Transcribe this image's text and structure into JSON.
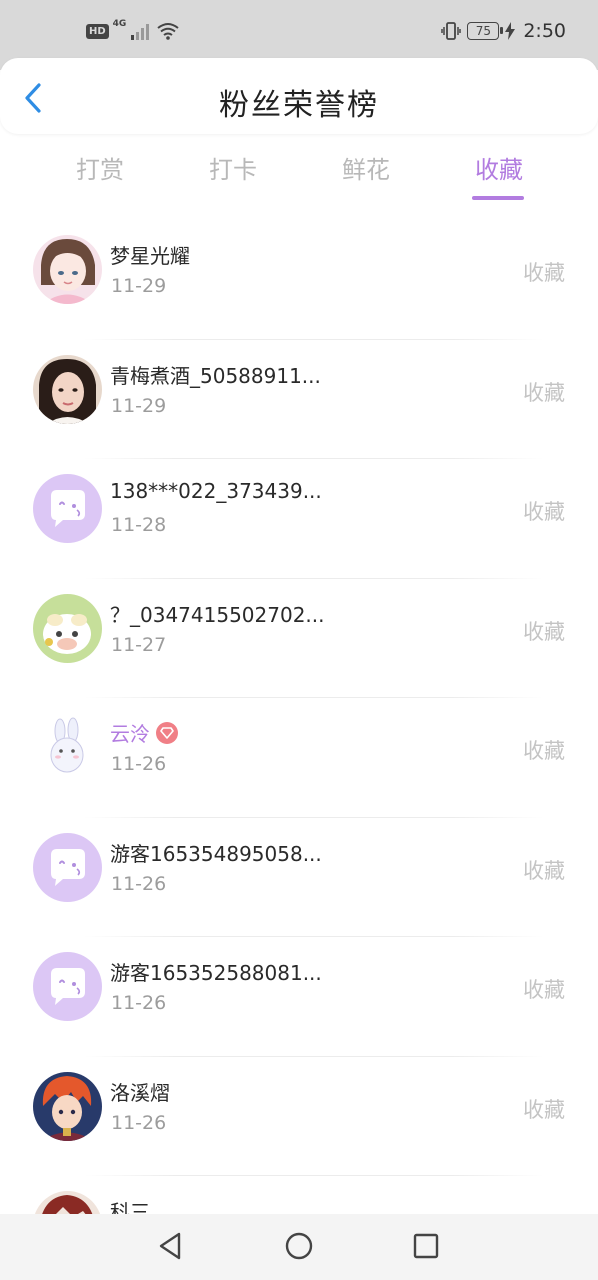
{
  "status_bar": {
    "badge": "HD",
    "network": "4G",
    "battery": "75",
    "time": "2:50"
  },
  "header": {
    "title": "粉丝荣誉榜"
  },
  "tabs": [
    {
      "label": "打赏",
      "active": false
    },
    {
      "label": "打卡",
      "active": false
    },
    {
      "label": "鲜花",
      "active": false
    },
    {
      "label": "收藏",
      "active": true
    }
  ],
  "colors": {
    "accent": "#b27ce0",
    "muted_text": "#9c9c9c",
    "action_text": "#c4c4c4",
    "avatar_default": "#dcc7f5"
  },
  "fans": [
    {
      "name": "梦星光耀",
      "date": "11-29",
      "action": "收藏",
      "avatar": "photo-girl-anime"
    },
    {
      "name": "青梅煮酒_50588911...",
      "date": "11-29",
      "action": "收藏",
      "avatar": "photo-woman"
    },
    {
      "name": "138***022_373439...",
      "date": "11-28",
      "action": "收藏",
      "avatar": "default-chat-bubble"
    },
    {
      "name": "？_0347415502702...",
      "date": "11-27",
      "action": "收藏",
      "avatar": "photo-cartoon-cow"
    },
    {
      "name": "云泠",
      "date": "11-26",
      "action": "收藏",
      "avatar": "photo-bunny",
      "vip": true
    },
    {
      "name": "游客165354895058...",
      "date": "11-26",
      "action": "收藏",
      "avatar": "default-chat-bubble"
    },
    {
      "name": "游客165352588081...",
      "date": "11-26",
      "action": "收藏",
      "avatar": "default-chat-bubble"
    },
    {
      "name": "洛溪熠",
      "date": "11-26",
      "action": "收藏",
      "avatar": "photo-anime-boy"
    },
    {
      "name": "科三",
      "date": "",
      "action": "",
      "avatar": "photo-partial"
    }
  ],
  "nav": {
    "back": "back-triangle-icon",
    "home": "home-circle-icon",
    "recent": "recent-square-icon"
  }
}
